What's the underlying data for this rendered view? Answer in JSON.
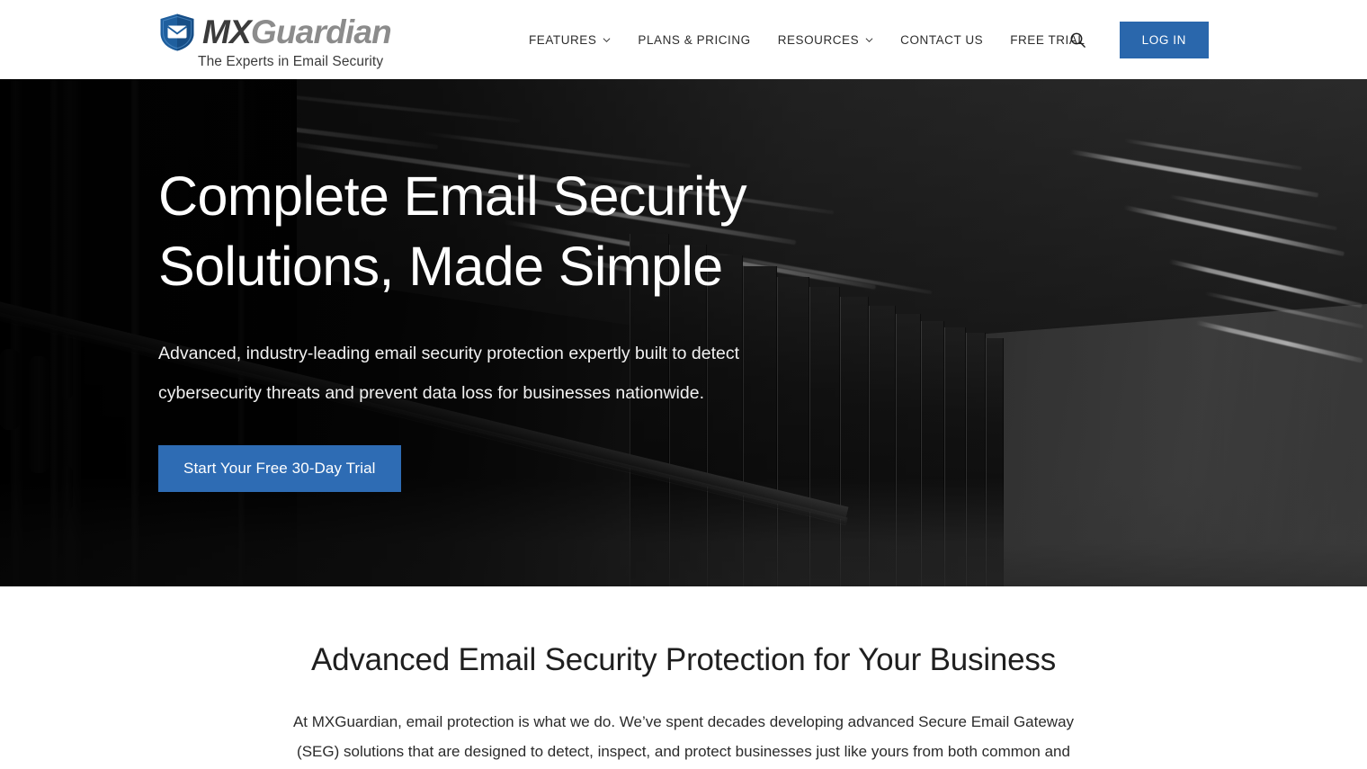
{
  "header": {
    "logo": {
      "icon": "shield-envelope-icon",
      "word_primary": "MX",
      "word_secondary": "Guardian",
      "tagline": "The Experts in Email Security",
      "shield_color": "#1f5f9e",
      "envelope_color": "#ffffff"
    },
    "nav": [
      {
        "label": "FEATURES",
        "has_dropdown": true,
        "icon": "chevron-down-icon"
      },
      {
        "label": "PLANS & PRICING",
        "has_dropdown": false,
        "icon": ""
      },
      {
        "label": "RESOURCES",
        "has_dropdown": true,
        "icon": "chevron-down-icon"
      },
      {
        "label": "CONTACT US",
        "has_dropdown": false,
        "icon": ""
      },
      {
        "label": "FREE TRIAL",
        "has_dropdown": false,
        "icon": ""
      }
    ],
    "search_icon": "search-icon",
    "login_label": "LOG IN",
    "login_bg": "#2a67ac"
  },
  "hero": {
    "title": "Complete Email Security Solutions, Made Simple",
    "subtitle": "Advanced, industry-leading email security protection expertly built to detect cybersecurity threats and prevent data loss for businesses nationwide.",
    "cta_label": "Start Your Free 30-Day Trial",
    "cta_bg": "#2e6cb4",
    "background_description": "dark data center server room"
  },
  "section": {
    "title": "Advanced Email Security Protection for Your Business",
    "body": "At MXGuardian, email protection is what we do. We’ve spent decades developing advanced Secure Email Gateway (SEG) solutions that are designed to detect, inspect, and protect businesses just like yours from both common and"
  }
}
